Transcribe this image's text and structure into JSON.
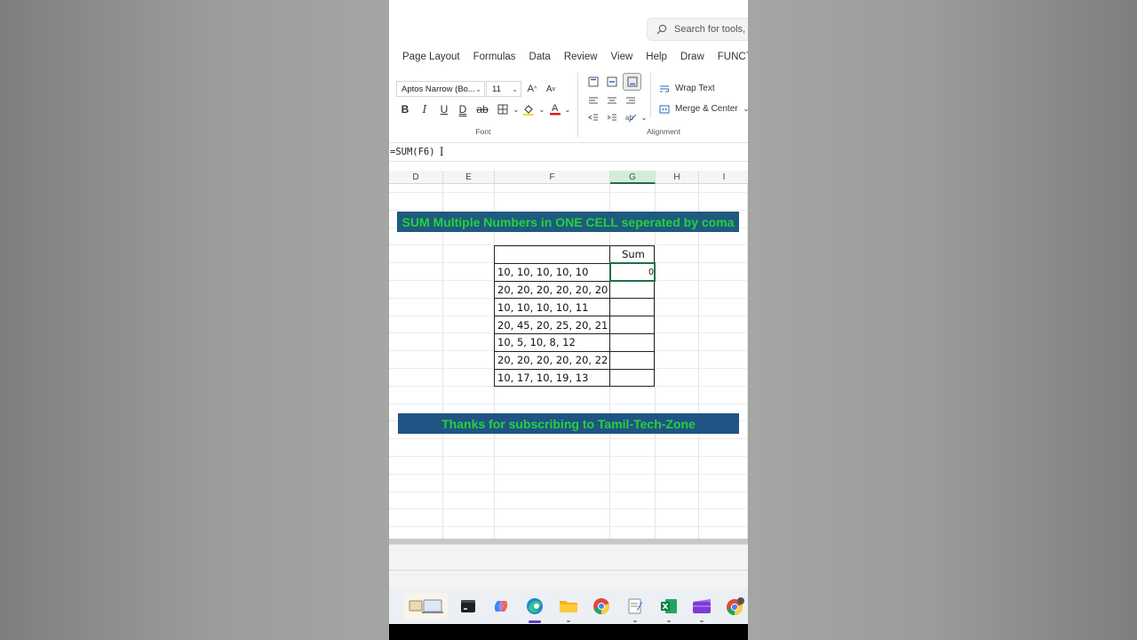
{
  "search": {
    "placeholder": "Search for tools,"
  },
  "ribbon": {
    "tabs": [
      "Page Layout",
      "Formulas",
      "Data",
      "Review",
      "View",
      "Help",
      "Draw",
      "FUNCT"
    ],
    "font_name": "Aptos Narrow (Bo...",
    "font_size": "11",
    "font_group_label": "Font",
    "alignment_group_label": "Alignment",
    "wrap_text_label": "Wrap Text",
    "merge_center_label": "Merge & Center"
  },
  "formula_bar": {
    "content": "=SUM(F6)"
  },
  "columns": [
    "D",
    "E",
    "F",
    "G",
    "H",
    "I"
  ],
  "active_column": "G",
  "sheet": {
    "title_banner": "SUM Multiple Numbers in ONE CELL seperated by coma",
    "table_header_sum": "Sum",
    "rows": [
      {
        "values": "10, 10, 10, 10, 10",
        "sum": "0"
      },
      {
        "values": "20, 20, 20, 20, 20, 20",
        "sum": ""
      },
      {
        "values": "10, 10, 10, 10, 11",
        "sum": ""
      },
      {
        "values": "20, 45, 20, 25, 20, 21",
        "sum": ""
      },
      {
        "values": "10, 5, 10, 8, 12",
        "sum": ""
      },
      {
        "values": "20, 20, 20, 20, 20, 22",
        "sum": ""
      },
      {
        "values": "10, 17, 10, 19, 13",
        "sum": ""
      }
    ],
    "footer_banner": "Thanks for subscribing to Tamil-Tech-Zone"
  },
  "colors": {
    "banner_bg": "#1f5484",
    "banner_text": "#22d33a",
    "excel_green": "#1e7145"
  },
  "taskbar": {
    "icons": [
      "widgets-icon",
      "terminal-icon",
      "copilot-icon",
      "edge-icon",
      "file-explorer-icon",
      "chrome-icon",
      "notepad-icon",
      "excel-icon",
      "clipchamp-icon",
      "chrome-profile-icon"
    ]
  }
}
